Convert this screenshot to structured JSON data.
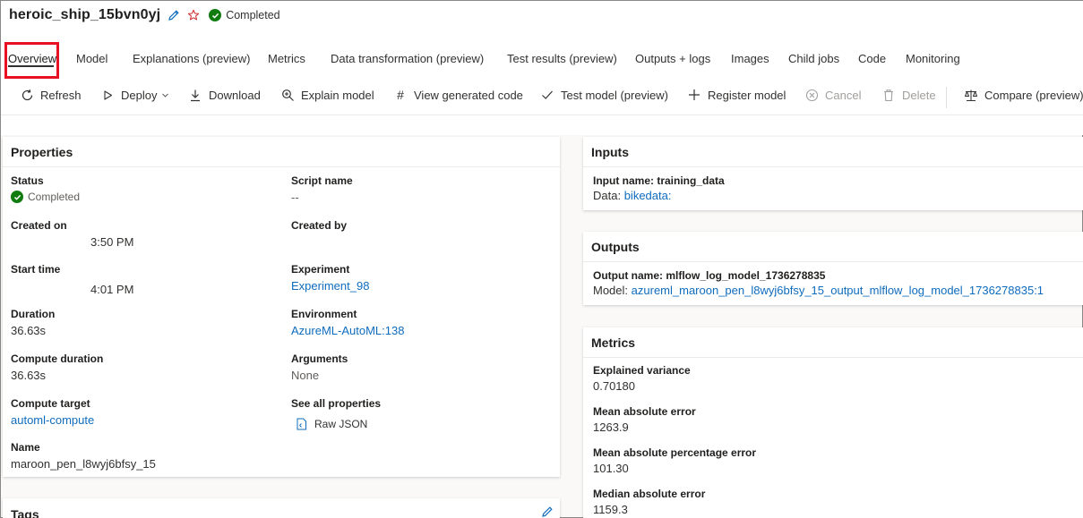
{
  "header": {
    "title": "heroic_ship_15bvn0yj",
    "status": "Completed"
  },
  "tabs": [
    {
      "label": "Overview"
    },
    {
      "label": "Model"
    },
    {
      "label": "Explanations (preview)"
    },
    {
      "label": "Metrics"
    },
    {
      "label": "Data transformation (preview)"
    },
    {
      "label": "Test results (preview)"
    },
    {
      "label": "Outputs + logs"
    },
    {
      "label": "Images"
    },
    {
      "label": "Child jobs"
    },
    {
      "label": "Code"
    },
    {
      "label": "Monitoring"
    }
  ],
  "toolbar": {
    "refresh": "Refresh",
    "deploy": "Deploy",
    "download": "Download",
    "explain": "Explain model",
    "view_code": "View generated code",
    "test_model": "Test model (preview)",
    "register": "Register model",
    "cancel": "Cancel",
    "delete": "Delete",
    "compare": "Compare (preview)"
  },
  "properties": {
    "header": "Properties",
    "status_label": "Status",
    "status_value": "Completed",
    "created_on_label": "Created on",
    "created_on_value": "3:50 PM",
    "start_time_label": "Start time",
    "start_time_value": "4:01 PM",
    "duration_label": "Duration",
    "duration_value": "36.63s",
    "compute_duration_label": "Compute duration",
    "compute_duration_value": "36.63s",
    "compute_target_label": "Compute target",
    "compute_target_value": "automl-compute",
    "name_label": "Name",
    "name_value": "maroon_pen_l8wyj6bfsy_15",
    "script_name_label": "Script name",
    "script_name_value": "--",
    "created_by_label": "Created by",
    "experiment_label": "Experiment",
    "experiment_value": "Experiment_98",
    "environment_label": "Environment",
    "environment_value": "AzureML-AutoML:138",
    "arguments_label": "Arguments",
    "arguments_value": "None",
    "see_all_label": "See all properties",
    "raw_json": "Raw JSON"
  },
  "tags": {
    "header": "Tags"
  },
  "inputs": {
    "header": "Inputs",
    "input_name": "Input name: training_data",
    "data_prefix": "Data:",
    "data_link": "bikedata:"
  },
  "outputs": {
    "header": "Outputs",
    "output_name": "Output name: mlflow_log_model_1736278835",
    "model_prefix": "Model:",
    "model_link": "azureml_maroon_pen_l8wyj6bfsy_15_output_mlflow_log_model_1736278835:1"
  },
  "metrics": {
    "header": "Metrics",
    "items": [
      {
        "label": "Explained variance",
        "value": "0.70180"
      },
      {
        "label": "Mean absolute error",
        "value": "1263.9"
      },
      {
        "label": "Mean absolute percentage error",
        "value": "101.30"
      },
      {
        "label": "Median absolute error",
        "value": "1159.3"
      }
    ]
  },
  "colors": {
    "link": "#0f6cbd",
    "success": "#107c10",
    "highlight_box": "#e81123"
  }
}
